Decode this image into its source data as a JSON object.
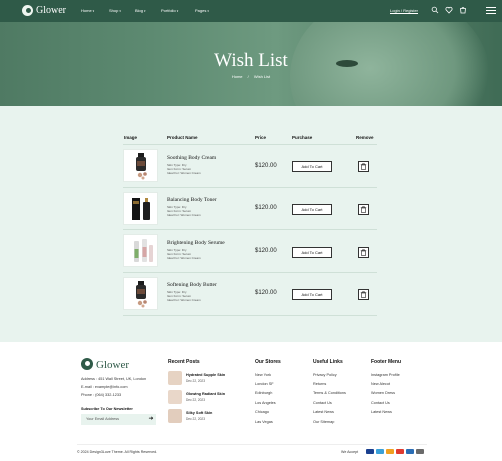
{
  "header": {
    "logo": "Glower",
    "nav": [
      {
        "label": "Home"
      },
      {
        "label": "Shop"
      },
      {
        "label": "Blog"
      },
      {
        "label": "Portfolio"
      },
      {
        "label": "Pages"
      }
    ],
    "login": "Login / Register"
  },
  "hero": {
    "title": "Wish List",
    "crumb_home": "Home",
    "crumb_sep": "/",
    "crumb_current": "Wish List"
  },
  "table": {
    "headers": {
      "image": "Image",
      "product": "Product Name",
      "price": "Price",
      "purchase": "Purchase",
      "remove": "Remove"
    },
    "rows": [
      {
        "name": "Soothing Body Cream",
        "meta1": "Skin Type: Dry",
        "meta2": "Item Form: Serum",
        "meta3": "Ideal For: Women Cream",
        "price": "$120.00",
        "button": "Add To Cart"
      },
      {
        "name": "Balancing Body Toner",
        "meta1": "Skin Type: Dry",
        "meta2": "Item Form: Serum",
        "meta3": "Ideal For: Women Cream",
        "price": "$120.00",
        "button": "Add To Cart"
      },
      {
        "name": "Brightening Body Serume",
        "meta1": "Skin Type: Dry",
        "meta2": "Item Form: Serum",
        "meta3": "Ideal For: Women Cream",
        "price": "$120.00",
        "button": "Add To Cart"
      },
      {
        "name": "Softening Body Butter",
        "meta1": "Skin Type: Dry",
        "meta2": "Item Form: Serum",
        "meta3": "Ideal For: Women Cream",
        "price": "$120.00",
        "button": "Add To Cart"
      }
    ]
  },
  "footer": {
    "logo": "Glower",
    "address": "Address : 451 Wall Street, UK, London",
    "email": "E-mail : example@info.com",
    "phone": "Phone : (064) 332-1233",
    "newsletter_title": "Subscribe To Our Newsletter",
    "newsletter_placeholder": "Your Email Address",
    "recent_posts_title": "Recent Posts",
    "posts": [
      {
        "title": "Hydrated Supple Skin",
        "date": "Dec 22, 2023"
      },
      {
        "title": "Glowing Radiant Skin",
        "date": "Dec 22, 2023"
      },
      {
        "title": "Silky Soft Skin",
        "date": "Dec 22, 2023"
      }
    ],
    "stores_title": "Our Stores",
    "stores": [
      "New York",
      "London SF",
      "Edinburgh",
      "Los Angeles",
      "Chicago",
      "Las Vegas"
    ],
    "links_title": "Useful Links",
    "links": [
      "Privacy Policy",
      "Returns",
      "Terms & Conditions",
      "Contact Us",
      "Latest News",
      "Our Sitemap"
    ],
    "menu_title": "Footer Menu",
    "menu": [
      "Instagram Profile",
      "New Alecot",
      "Women Dress",
      "Contact Us",
      "Latest News"
    ],
    "copyright": "© 2024 Design3Love Theme. All Rights Reserved.",
    "accept": "We Accept"
  },
  "colors": {
    "brand": "#2f5a48",
    "mint": "#e8f3ee"
  }
}
